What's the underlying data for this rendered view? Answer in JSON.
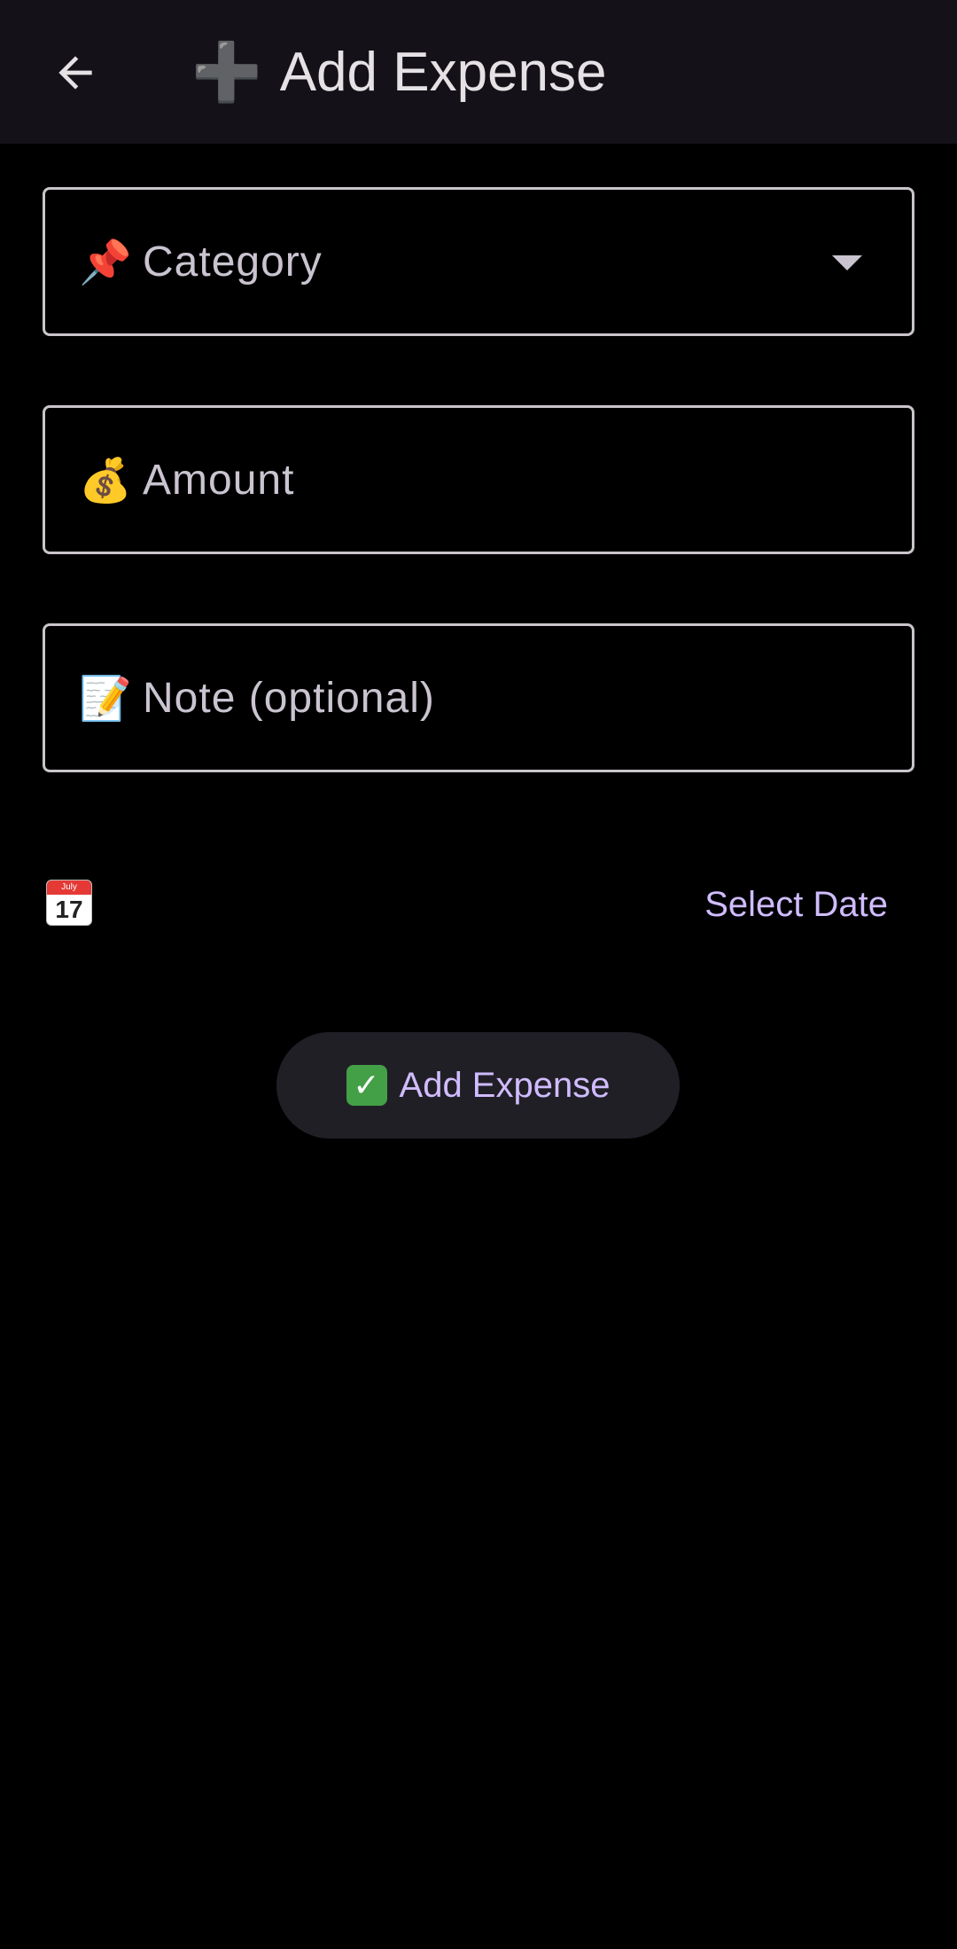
{
  "app_bar": {
    "title_emoji": "➕",
    "title": "Add Expense"
  },
  "form": {
    "category": {
      "emoji": "📌",
      "placeholder": "Category"
    },
    "amount": {
      "emoji": "💰",
      "placeholder": "Amount"
    },
    "note": {
      "emoji": "📝",
      "placeholder": "Note (optional)"
    }
  },
  "date": {
    "calendar_month": "July",
    "calendar_day": "17",
    "select_label": "Select Date"
  },
  "submit": {
    "emoji": "✓",
    "label": "Add Expense"
  },
  "colors": {
    "app_bar_bg": "#141218",
    "accent": "#d0bcff",
    "button_bg": "#211f26",
    "check_green": "#43a047"
  }
}
